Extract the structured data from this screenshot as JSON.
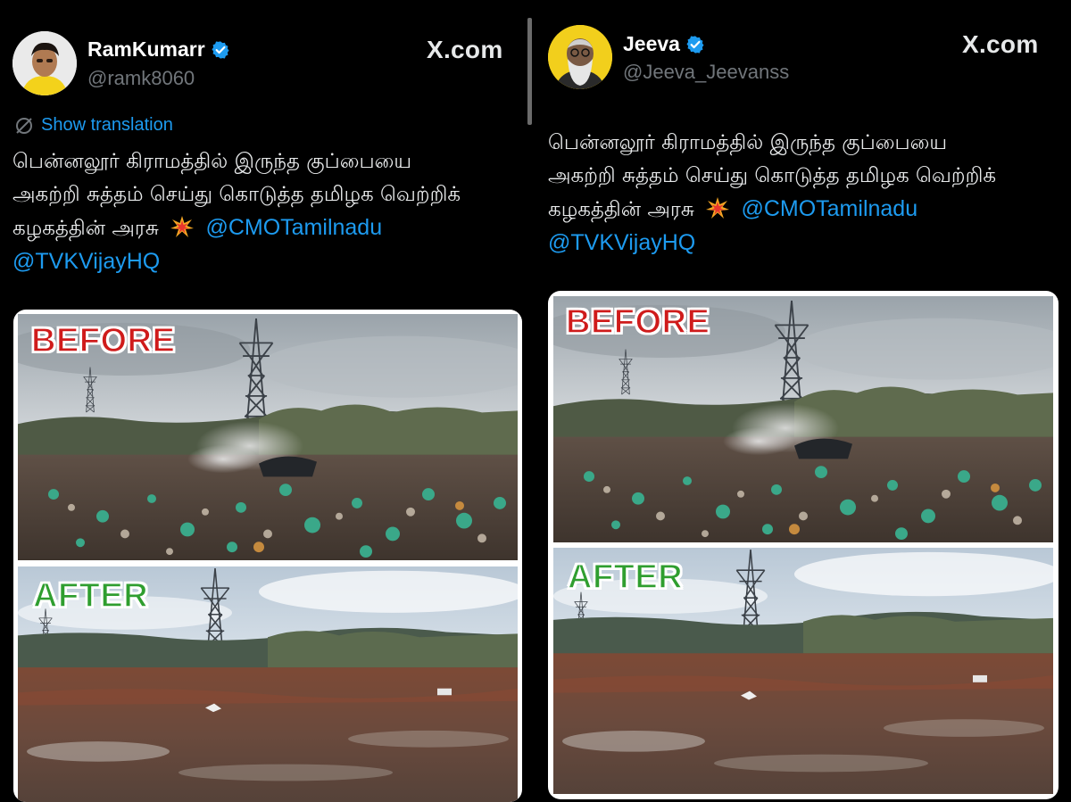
{
  "posts": [
    {
      "display_name": "RamKumarr",
      "handle": "@ramk8060",
      "source_label": "X.com",
      "show_translation": "Show translation",
      "text_line_1": "பென்னலூர் கிராமத்தில் இருந்த குப்பையை",
      "text_line_2": "அகற்றி சுத்தம் செய்து கொடுத்த தமிழக வெற்றிக்",
      "text_line_3": "கழகத்தின் அரசு",
      "mention_1": "@CMOTamilnadu",
      "mention_2": "@TVKVijayHQ",
      "before_label": "BEFORE",
      "after_label": "AFTER"
    },
    {
      "display_name": "Jeeva",
      "handle": "@Jeeva_Jeevanss",
      "source_label": "X.com",
      "text_line_1": "பென்னலூர் கிராமத்தில் இருந்த குப்பையை",
      "text_line_2": "அகற்றி சுத்தம் செய்து கொடுத்த தமிழக வெற்றிக்",
      "text_line_3": "கழகத்தின் அரசு",
      "mention_1": "@CMOTamilnadu",
      "mention_2": "@TVKVijayHQ",
      "before_label": "BEFORE",
      "after_label": "AFTER"
    }
  ],
  "icons": {
    "verified": "verified-badge-icon",
    "translate": "translate-icon",
    "emoji": "collision-emoji-icon"
  },
  "colors": {
    "background": "#000000",
    "link": "#1d9bf0",
    "verified": "#1d9bf0",
    "before_label": "#cf1b1b",
    "after_label": "#2f9e2f"
  }
}
